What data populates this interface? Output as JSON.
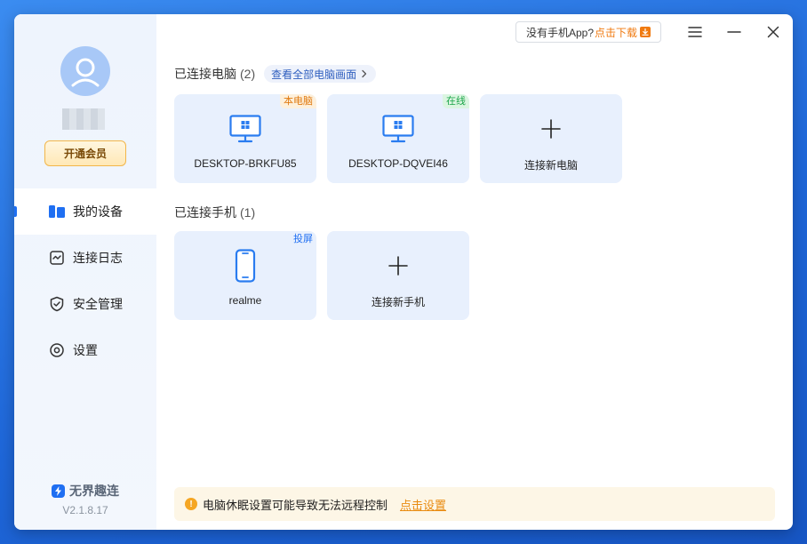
{
  "sidebar": {
    "vip_label": "开通会员",
    "nav": [
      {
        "label": "我的设备",
        "icon": "devices-icon",
        "active": true
      },
      {
        "label": "连接日志",
        "icon": "log-icon",
        "active": false
      },
      {
        "label": "安全管理",
        "icon": "shield-icon",
        "active": false
      },
      {
        "label": "设置",
        "icon": "settings-icon",
        "active": false
      }
    ],
    "brand": "无界趣连",
    "version": "V2.1.8.17"
  },
  "topbar": {
    "promo_text": "没有手机App?",
    "promo_link": "点击下载"
  },
  "computers": {
    "title": "已连接电脑",
    "count": "(2)",
    "view_all": "查看全部电脑画面",
    "cards": [
      {
        "label": "DESKTOP-BRKFU85",
        "badge": "本电脑",
        "icon": "monitor-icon"
      },
      {
        "label": "DESKTOP-DQVEI46",
        "badge": "在线",
        "icon": "monitor-icon"
      },
      {
        "label": "连接新电脑",
        "icon": "plus-icon"
      }
    ]
  },
  "phones": {
    "title": "已连接手机",
    "count": "(1)",
    "cards": [
      {
        "label": "realme",
        "badge": "投屏",
        "icon": "phone-icon"
      },
      {
        "label": "连接新手机",
        "icon": "plus-icon"
      }
    ]
  },
  "tip": {
    "text": "电脑休眠设置可能导致无法远程控制",
    "link": "点击设置"
  },
  "colors": {
    "accent": "#1f6ff2",
    "card_bg": "#e8f0fd",
    "vip_border": "#f2b64a",
    "warning": "#f5a623",
    "link_orange": "#e98b10"
  }
}
